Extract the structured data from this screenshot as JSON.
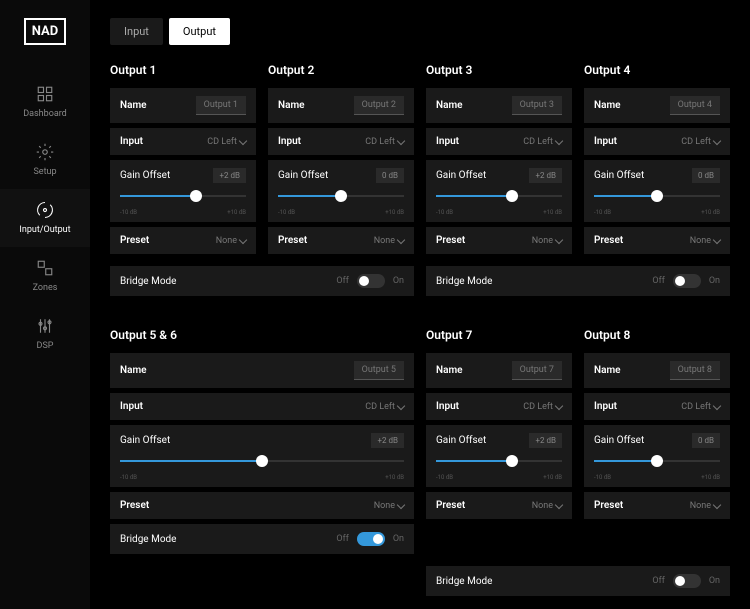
{
  "brand": "NAD",
  "nav": [
    {
      "id": "dashboard",
      "label": "Dashboard"
    },
    {
      "id": "setup",
      "label": "Setup"
    },
    {
      "id": "io",
      "label": "Input/Output"
    },
    {
      "id": "zones",
      "label": "Zones"
    },
    {
      "id": "dsp",
      "label": "DSP"
    }
  ],
  "tabs": {
    "input": "Input",
    "output": "Output"
  },
  "labels": {
    "name": "Name",
    "input": "Input",
    "gain": "Gain Offset",
    "preset": "Preset",
    "bridge": "Bridge Mode",
    "off": "Off",
    "on": "On",
    "none": "None"
  },
  "ticks": {
    "min": "-10 dB",
    "max": "+10 dB"
  },
  "outputs": [
    {
      "title": "Output 1",
      "name": "Output 1",
      "input": "CD Left",
      "gain": "+2 dB",
      "slider": 60,
      "preset": "None"
    },
    {
      "title": "Output 2",
      "name": "Output 2",
      "input": "CD Left",
      "gain": "0 dB",
      "slider": 50,
      "preset": "None"
    },
    {
      "title": "Output 3",
      "name": "Output 3",
      "input": "CD Left",
      "gain": "+2 dB",
      "slider": 60,
      "preset": "None"
    },
    {
      "title": "Output 4",
      "name": "Output 4",
      "input": "CD Left",
      "gain": "0 dB",
      "slider": 50,
      "preset": "None"
    },
    {
      "title": "Output 5 & 6",
      "name": "Output 5",
      "input": "CD Left",
      "gain": "+2 dB",
      "slider": 50,
      "preset": "None",
      "wide": true,
      "bridge": true
    },
    {
      "title": "Output 7",
      "name": "Output 7",
      "input": "CD Left",
      "gain": "+2 dB",
      "slider": 60,
      "preset": "None"
    },
    {
      "title": "Output 8",
      "name": "Output 8",
      "input": "CD Left",
      "gain": "0 dB",
      "slider": 50,
      "preset": "None"
    }
  ],
  "bridgeTop": {
    "left": false,
    "right": false
  },
  "bridgeBottom": {
    "left": true,
    "right": false
  }
}
